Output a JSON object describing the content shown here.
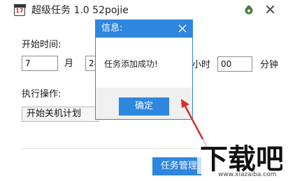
{
  "window": {
    "title": "超级任务 1.0 52pojie",
    "app_icon_text": "17",
    "icons": [
      "calendar-icon",
      "skin-icon",
      "close-icon"
    ]
  },
  "form": {
    "start_time_label": "开始时间:",
    "month_value": "7",
    "month_label": "月",
    "day_value": "28",
    "hour_label": "小时",
    "minute_value": "00",
    "minute_label": "分钟",
    "action_label": "执行操作:",
    "action_value": "开始关机计划",
    "task_manage_button": "任务管理"
  },
  "dialog": {
    "title": "信息:",
    "message": "任务添加成功!",
    "ok_button": "确定"
  },
  "watermark": {
    "logo_text": "下载吧",
    "url": "www.xiazaiba.com"
  },
  "colors": {
    "accent": "#2e86de",
    "arrow": "#d32f2f",
    "footer_bg": "#f0f0f0"
  }
}
